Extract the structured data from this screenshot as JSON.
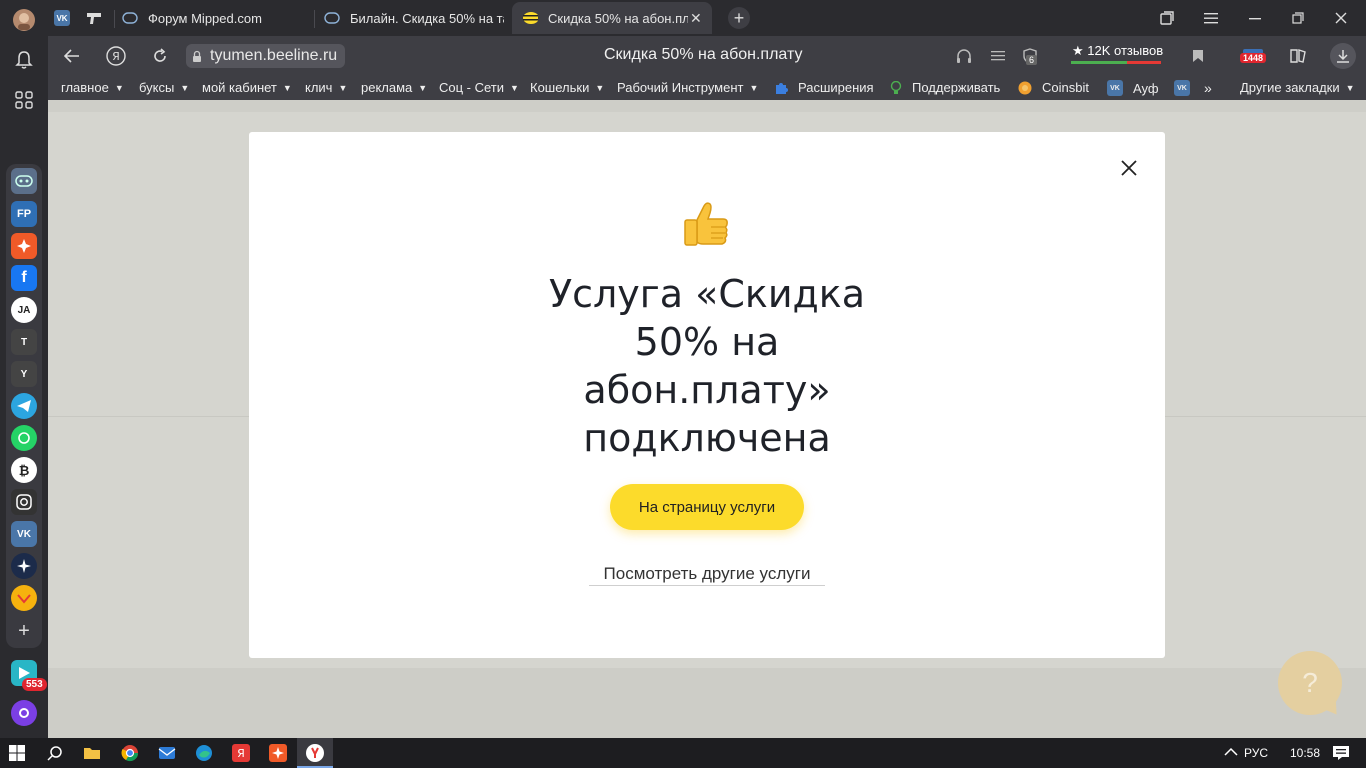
{
  "tabs": [
    {
      "label": "Форум Mipped.com"
    },
    {
      "label": "Билайн. Скидка 50% на та"
    },
    {
      "label": "Скидка 50% на абон.пл"
    }
  ],
  "address_bar": {
    "url": "tyumen.beeline.ru",
    "page_title": "Скидка 50% на абон.плату",
    "badge_count": "6",
    "reviews": "★ 12K отзывов",
    "mail_count": "1448"
  },
  "bookmarks": [
    {
      "label": "главное",
      "dropdown": true
    },
    {
      "label": "буксы",
      "dropdown": true
    },
    {
      "label": "мой кабинет",
      "dropdown": true
    },
    {
      "label": "клич",
      "dropdown": true
    },
    {
      "label": "реклама",
      "dropdown": true
    },
    {
      "label": "Соц - Сети",
      "dropdown": true
    },
    {
      "label": "Кошельки",
      "dropdown": true
    },
    {
      "label": "Рабочий Инструмент",
      "dropdown": true
    },
    {
      "label": "Расширения",
      "dropdown": false
    },
    {
      "label": "Поддерживать",
      "dropdown": false
    },
    {
      "label": "Coinsbit",
      "dropdown": false
    },
    {
      "label": "Ауф",
      "dropdown": false
    }
  ],
  "bookmarks_other": "Другие закладки",
  "sidebar": {
    "fp_label": "FP",
    "t_label": "T",
    "y_label": "Y",
    "badge_count": "553"
  },
  "modal": {
    "title": "Услуга «Скидка 50% на абон.плату» подключена",
    "cta_label": "На страницу услуги",
    "other_link": "Посмотреть другие услуги"
  },
  "help_label": "?",
  "taskbar": {
    "language": "РУС",
    "time": "10:58"
  },
  "colors": {
    "accent_yellow": "#fcdb2b",
    "browser_dark": "#2b2b2f",
    "page_bg": "#d5d5cf"
  }
}
